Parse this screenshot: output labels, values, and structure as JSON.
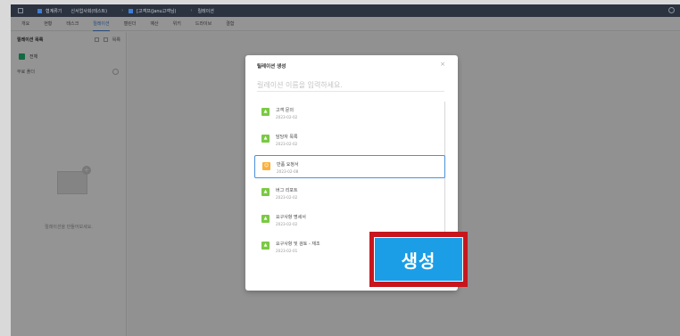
{
  "topbar": {
    "crumbs": [
      "협계류기",
      "신서업사회(테스트)",
      "[고객프(Janu고객님)",
      "릴레이션"
    ]
  },
  "tabs": [
    "개요",
    "현황",
    "태스크",
    "릴레이션",
    "캘린더",
    "예산",
    "위키",
    "드라이브",
    "결함"
  ],
  "active_tab_index": 3,
  "sidebar": {
    "header": "릴레이션 목록",
    "action_label": "목록",
    "all_label": "전체",
    "section_label": "무료 폴더",
    "empty_text": "릴레이션을 만들어보세요."
  },
  "modal": {
    "title": "릴레이션 생성",
    "close": "×",
    "name_placeholder": "릴레이션 이름을 입력하세요.",
    "documents": [
      {
        "name": "고객 문의",
        "date": "2023-02-02",
        "icon": "doc-icon-green"
      },
      {
        "name": "담당자 목록",
        "date": "2023-02-02",
        "icon": "doc-icon-green"
      },
      {
        "name": "반품 요청서",
        "date": "2023-02-08",
        "icon": "doc-icon-orange"
      },
      {
        "name": "버그 리포트",
        "date": "2023-02-02",
        "icon": "doc-icon-green"
      },
      {
        "name": "요구사항 명세서",
        "date": "2023-02-02",
        "icon": "doc-icon-green"
      },
      {
        "name": "요구사항 및 검토 - 재조",
        "date": "2023-02-01",
        "icon": "doc-icon-green"
      }
    ],
    "selected_index": 2
  },
  "create_button": {
    "label": "생성"
  },
  "colors": {
    "accent": "#3d7fd6",
    "create_button": "#1b9ee6",
    "highlight_border": "#c8161d"
  }
}
